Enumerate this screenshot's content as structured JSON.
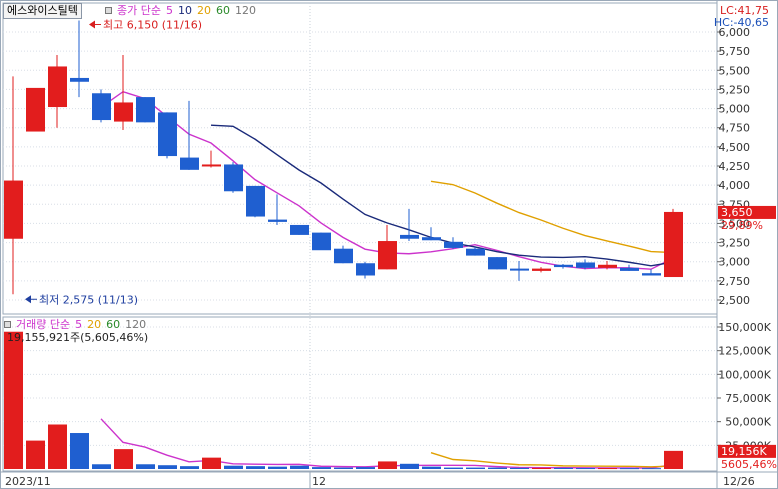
{
  "ticker": {
    "name": "에스와이스틸텍"
  },
  "price_legend": {
    "title": "종가 단순",
    "periods": [
      "5",
      "10",
      "20",
      "60",
      "120"
    ],
    "colors": [
      "#cc33cc",
      "#1a2a7a",
      "#e0a000",
      "#2a8a2a",
      "#777777"
    ]
  },
  "volume_legend": {
    "title": "거래량 단순",
    "periods": [
      "5",
      "20",
      "60",
      "120"
    ],
    "colors": [
      "#cc33cc",
      "#e0a000",
      "#2a8a2a",
      "#777777"
    ]
  },
  "info": {
    "lc": "LC:41,75",
    "hc": "HC:-40,65"
  },
  "annotations": {
    "high": "최고 6,150 (11/16)",
    "low": "최저 2,575 (11/13)",
    "volume_info": "19,155,921주(5,605,46%)"
  },
  "price_axis": {
    "ticks": [
      "6,000",
      "5,750",
      "5,500",
      "5,250",
      "5,000",
      "4,750",
      "4,500",
      "4,250",
      "4,000",
      "3,750",
      "3,500",
      "3,250",
      "3,000",
      "2,750",
      "2,500"
    ],
    "current_label": "3,650",
    "pct_label": "29,89%"
  },
  "volume_axis": {
    "ticks": [
      "150,000K",
      "125,000K",
      "100,000K",
      "75,000K",
      "50,000K",
      "25,000K"
    ],
    "current_label": "19,156K",
    "pct_label": "5605,46%"
  },
  "x_axis": {
    "labels": [
      "2023/11",
      "12",
      "12/26"
    ]
  },
  "chart_data": {
    "type": "candlestick",
    "candles": [
      {
        "o": 3300,
        "h": 5420,
        "l": 2575,
        "c": 4060,
        "v": 145000
      },
      {
        "o": 4700,
        "h": 5250,
        "l": 4700,
        "c": 5270,
        "v": 30000
      },
      {
        "o": 5020,
        "h": 5700,
        "l": 4750,
        "c": 5550,
        "v": 47000
      },
      {
        "o": 5400,
        "h": 6150,
        "l": 5150,
        "c": 5350,
        "v": 38000
      },
      {
        "o": 5200,
        "h": 5250,
        "l": 4820,
        "c": 4850,
        "v": 5000
      },
      {
        "o": 4830,
        "h": 5700,
        "l": 4720,
        "c": 5080,
        "v": 21000
      },
      {
        "o": 5150,
        "h": 5150,
        "l": 4820,
        "c": 4820,
        "v": 5000
      },
      {
        "o": 4950,
        "h": 4950,
        "l": 4350,
        "c": 4380,
        "v": 4000
      },
      {
        "o": 4360,
        "h": 5100,
        "l": 4200,
        "c": 4200,
        "v": 3000
      },
      {
        "o": 4260,
        "h": 4450,
        "l": 4230,
        "c": 4270,
        "v": 12000
      },
      {
        "o": 4270,
        "h": 4300,
        "l": 3900,
        "c": 3920,
        "v": 3500
      },
      {
        "o": 3990,
        "h": 3990,
        "l": 3580,
        "c": 3590,
        "v": 3000
      },
      {
        "o": 3550,
        "h": 3880,
        "l": 3480,
        "c": 3520,
        "v": 2500
      },
      {
        "o": 3480,
        "h": 3480,
        "l": 3350,
        "c": 3350,
        "v": 3500
      },
      {
        "o": 3380,
        "h": 3380,
        "l": 3170,
        "c": 3150,
        "v": 2000
      },
      {
        "o": 3170,
        "h": 3210,
        "l": 2980,
        "c": 2980,
        "v": 1500
      },
      {
        "o": 2980,
        "h": 3000,
        "l": 2780,
        "c": 2820,
        "v": 2000
      },
      {
        "o": 2900,
        "h": 3480,
        "l": 2900,
        "c": 3270,
        "v": 8000
      },
      {
        "o": 3350,
        "h": 3690,
        "l": 3270,
        "c": 3300,
        "v": 5500
      },
      {
        "o": 3320,
        "h": 3450,
        "l": 3280,
        "c": 3280,
        "v": 2500
      },
      {
        "o": 3260,
        "h": 3320,
        "l": 3170,
        "c": 3180,
        "v": 1500
      },
      {
        "o": 3170,
        "h": 3190,
        "l": 3080,
        "c": 3080,
        "v": 1500
      },
      {
        "o": 3060,
        "h": 3060,
        "l": 2900,
        "c": 2900,
        "v": 1500
      },
      {
        "o": 2910,
        "h": 3010,
        "l": 2750,
        "c": 2890,
        "v": 1200
      },
      {
        "o": 2880,
        "h": 2930,
        "l": 2860,
        "c": 2910,
        "v": 1200
      },
      {
        "o": 2960,
        "h": 2970,
        "l": 2910,
        "c": 2930,
        "v": 1200
      },
      {
        "o": 2990,
        "h": 3030,
        "l": 2900,
        "c": 2920,
        "v": 1000
      },
      {
        "o": 2920,
        "h": 3010,
        "l": 2900,
        "c": 2960,
        "v": 1000
      },
      {
        "o": 2920,
        "h": 2960,
        "l": 2880,
        "c": 2880,
        "v": 900
      },
      {
        "o": 2850,
        "h": 2900,
        "l": 2820,
        "c": 2820,
        "v": 900
      },
      {
        "o": 2800,
        "h": 3690,
        "l": 2800,
        "c": 3650,
        "v": 19156
      }
    ]
  }
}
